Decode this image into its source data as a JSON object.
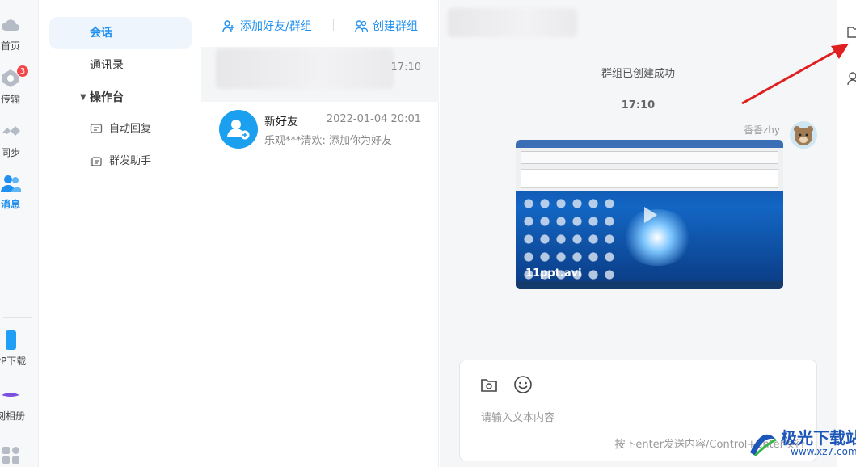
{
  "rail": {
    "items": [
      {
        "label": "首页",
        "icon": "cloud-icon"
      },
      {
        "label": "传输",
        "icon": "transfer-icon",
        "badge": "3"
      },
      {
        "label": "同步",
        "icon": "sync-icon"
      },
      {
        "label": "消息",
        "icon": "message-icon",
        "active": true
      },
      {
        "label": "PP下载",
        "icon": "phone-icon"
      },
      {
        "label": "刻相册",
        "icon": "album-icon"
      }
    ]
  },
  "nav": {
    "session": "会话",
    "contacts": "通讯录",
    "console": "操作台",
    "auto_reply": "自动回复",
    "group_send": "群发助手"
  },
  "list": {
    "add_friend": "添加好友/群组",
    "create_group": "创建群组",
    "conversations": [
      {
        "name": "",
        "time": "17:10",
        "preview": ""
      },
      {
        "name": "新好友",
        "time": "2022-01-04 20:01",
        "preview": "乐观***清欢: 添加你为好友"
      }
    ]
  },
  "chat": {
    "system_msg": "群组已创建成功",
    "time": "17:10",
    "sender": "香香zhy",
    "video_name": "11ppt.avi",
    "input_placeholder": "请输入文本内容",
    "send_hint": "按下enter发送内容/Control+enter换行"
  },
  "watermark": {
    "title": "极光下载站",
    "url": "www.xz7.com"
  },
  "colors": {
    "accent": "#1f8ff0",
    "badge": "#f2484b",
    "arrow": "#e02020"
  }
}
